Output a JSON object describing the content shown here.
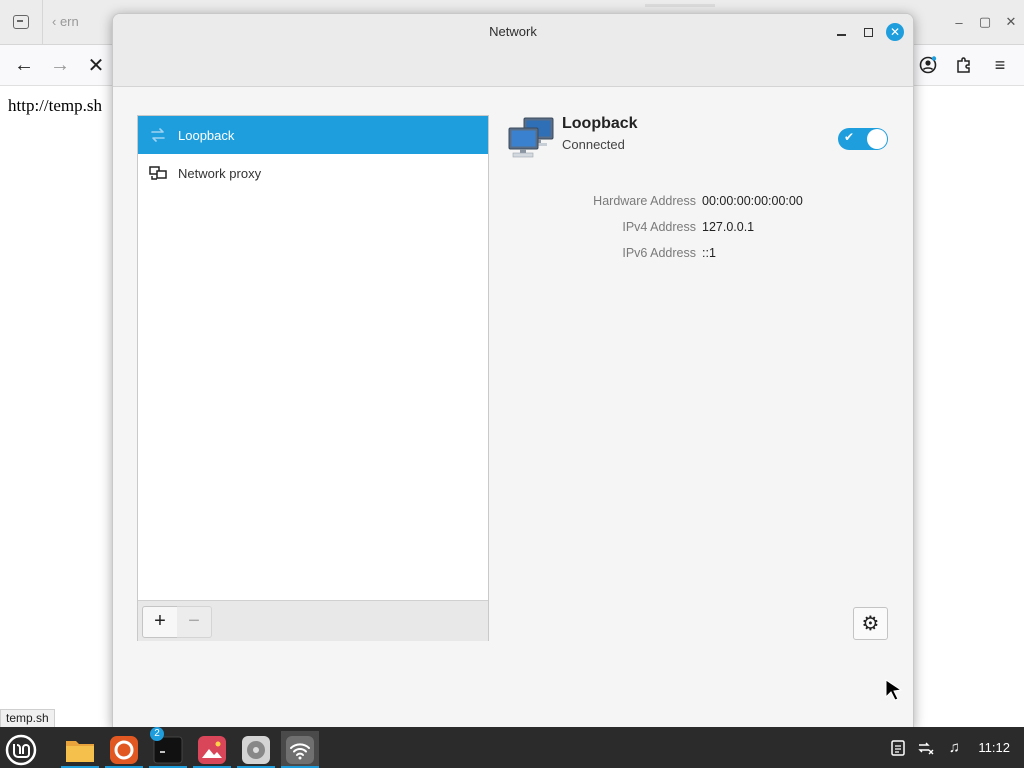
{
  "browser": {
    "tab_fragment": "ern",
    "page_url_text": "http://temp.sh",
    "status_url": "temp.sh",
    "icons": {
      "back": "arrow-left-icon",
      "forward": "arrow-right-icon",
      "stop": "x-icon",
      "account": "account-icon",
      "extensions": "puzzle-icon",
      "menu": "hamburger-icon"
    }
  },
  "window": {
    "title": "Network"
  },
  "connections": [
    {
      "label": "Loopback",
      "icon": "loopback-arrows-icon",
      "selected": true
    },
    {
      "label": "Network proxy",
      "icon": "network-proxy-icon",
      "selected": false
    }
  ],
  "list_toolbar": {
    "add_label": "+",
    "remove_label": "−"
  },
  "detail": {
    "name": "Loopback",
    "status": "Connected",
    "enabled": true,
    "icon": "wired-network-computers-icon",
    "properties": [
      {
        "label": "Hardware Address",
        "value": "00:00:00:00:00:00"
      },
      {
        "label": "IPv4 Address",
        "value": "127.0.0.1"
      },
      {
        "label": "IPv6 Address",
        "value": "::1"
      }
    ]
  },
  "taskbar": {
    "terminal_badge": "2",
    "clock": "11:12",
    "accent": "#1f9ede"
  }
}
